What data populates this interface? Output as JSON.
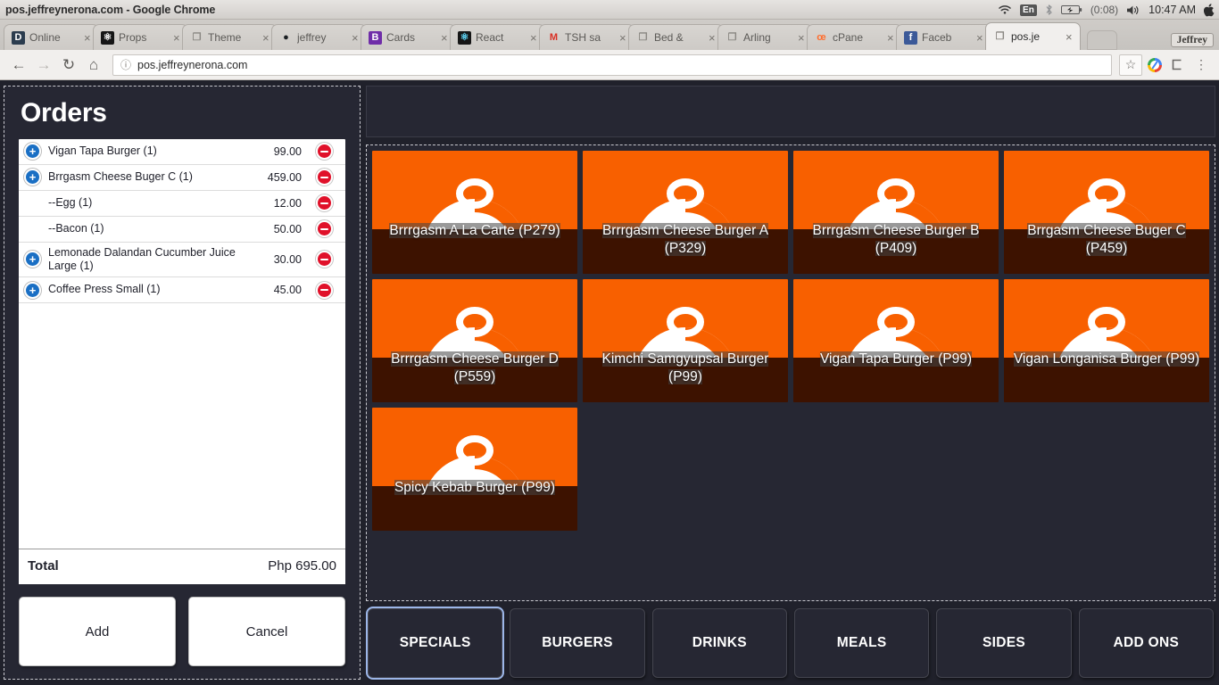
{
  "window": {
    "title": "pos.jeffreynerona.com - Google Chrome"
  },
  "tray": {
    "wifi_icon": "wifi-icon",
    "language": "En",
    "bluetooth_icon": "bluetooth-icon",
    "battery_icon": "battery-icon",
    "battery_time": "(0:08)",
    "volume_icon": "volume-icon",
    "clock": "10:47 AM",
    "apple_icon": "apple-icon"
  },
  "browser": {
    "tabs": [
      {
        "title": "Online",
        "favicon_name": "drupal-favicon",
        "favicon_glyph": "D",
        "favicon_bg": "#2b3c4e",
        "favicon_fg": "#ffffff",
        "active": false
      },
      {
        "title": "Props",
        "favicon_name": "react-favicon",
        "favicon_glyph": "⚛",
        "favicon_bg": "#161616",
        "favicon_fg": "#ffffff",
        "active": false
      },
      {
        "title": "Theme",
        "favicon_name": "page-favicon",
        "favicon_glyph": "❐",
        "favicon_bg": "transparent",
        "favicon_fg": "#8a8782",
        "active": false
      },
      {
        "title": "jeffrey",
        "favicon_name": "github-favicon",
        "favicon_glyph": "●",
        "favicon_bg": "transparent",
        "favicon_fg": "#1b1f23",
        "active": false
      },
      {
        "title": "Cards",
        "favicon_name": "bitbucket-favicon",
        "favicon_glyph": "B",
        "favicon_bg": "#6f2da8",
        "favicon_fg": "#ffffff",
        "active": false
      },
      {
        "title": "React",
        "favicon_name": "react-favicon",
        "favicon_glyph": "⚛",
        "favicon_bg": "#161616",
        "favicon_fg": "#61dafb",
        "active": false
      },
      {
        "title": "TSH sa",
        "favicon_name": "gmail-favicon",
        "favicon_glyph": "M",
        "favicon_bg": "transparent",
        "favicon_fg": "#d93025",
        "active": false
      },
      {
        "title": "Bed &",
        "favicon_name": "page-favicon",
        "favicon_glyph": "❐",
        "favicon_bg": "transparent",
        "favicon_fg": "#8a8782",
        "active": false
      },
      {
        "title": "Arling",
        "favicon_name": "page-favicon",
        "favicon_glyph": "❐",
        "favicon_bg": "transparent",
        "favicon_fg": "#8a8782",
        "active": false
      },
      {
        "title": "cPane",
        "favicon_name": "cpanel-favicon",
        "favicon_glyph": "œ",
        "favicon_bg": "transparent",
        "favicon_fg": "#ff6c2c",
        "active": false
      },
      {
        "title": "Faceb",
        "favicon_name": "facebook-favicon",
        "favicon_glyph": "f",
        "favicon_bg": "#3b5998",
        "favicon_fg": "#ffffff",
        "active": false
      },
      {
        "title": "pos.je",
        "favicon_name": "page-favicon",
        "favicon_glyph": "❐",
        "favicon_bg": "transparent",
        "favicon_fg": "#8a8782",
        "active": true
      }
    ],
    "user_chip": "Jeffrey",
    "nav": {
      "back_icon": "back-arrow-icon",
      "forward_icon": "forward-arrow-icon",
      "reload_icon": "reload-icon",
      "home_icon": "home-icon"
    },
    "address": {
      "info_icon": "site-info-icon",
      "url": "pos.jeffreynerona.com"
    },
    "toolbar": {
      "bookmark_icon": "star-icon",
      "extension_icon": "extension-icon",
      "cast_icon": "cast-icon",
      "menu_icon": "three-dot-menu-icon"
    }
  },
  "orders": {
    "title": "Orders",
    "items": [
      {
        "name": "Vigan Tapa Burger (1)",
        "price": "99.00",
        "has_add": true
      },
      {
        "name": "Brrgasm Cheese Buger C (1)",
        "price": "459.00",
        "has_add": true
      },
      {
        "name": "--Egg (1)",
        "price": "12.00",
        "has_add": false
      },
      {
        "name": "--Bacon (1)",
        "price": "50.00",
        "has_add": false
      },
      {
        "name": "Lemonade Dalandan Cucumber Juice Large (1)",
        "price": "30.00",
        "has_add": true
      },
      {
        "name": "Coffee Press Small (1)",
        "price": "45.00",
        "has_add": true
      }
    ],
    "total_label": "Total",
    "total_value": "Php 695.00",
    "add_label": "Add",
    "cancel_label": "Cancel"
  },
  "products": [
    {
      "label": "Brrrgasm A La Carte (P279)"
    },
    {
      "label": "Brrrgasm Cheese Burger A (P329)"
    },
    {
      "label": "Brrrgasm Cheese Burger B (P409)"
    },
    {
      "label": "Brrgasm Cheese Buger C (P459)"
    },
    {
      "label": "Brrrgasm Cheese Burger D (P559)"
    },
    {
      "label": "Kimchi Samgyupsal Burger (P99)"
    },
    {
      "label": "Vigan Tapa Burger (P99)"
    },
    {
      "label": "Vigan Longanisa Burger (P99)"
    },
    {
      "label": "Spicy Kebab Burger (P99)"
    }
  ],
  "categories": [
    {
      "label": "SPECIALS",
      "focused": true
    },
    {
      "label": "BURGERS",
      "focused": false
    },
    {
      "label": "DRINKS",
      "focused": false
    },
    {
      "label": "MEALS",
      "focused": false
    },
    {
      "label": "SIDES",
      "focused": false
    },
    {
      "label": "ADD ONS",
      "focused": false
    }
  ],
  "colors": {
    "panel_bg": "#262733",
    "page_bg": "#20212b",
    "tile_image_bg": "#f86000",
    "tile_label_bg": "#3d1200",
    "add_button": "#1a6fc4",
    "remove_button": "#e0112a",
    "focus_ring": "#9cb6e8"
  }
}
